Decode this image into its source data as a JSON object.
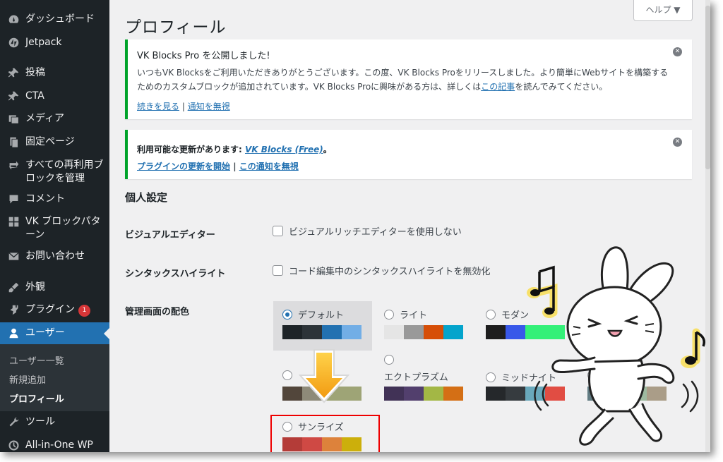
{
  "sidebar": {
    "items": [
      {
        "label": "ダッシュボード",
        "icon": "dashboard-icon"
      },
      {
        "label": "Jetpack",
        "icon": "jetpack-icon"
      },
      {
        "label": "投稿",
        "icon": "pin-icon"
      },
      {
        "label": "CTA",
        "icon": "pin-icon"
      },
      {
        "label": "メディア",
        "icon": "media-icon"
      },
      {
        "label": "固定ページ",
        "icon": "page-icon"
      },
      {
        "label": "すべての再利用ブロックを管理",
        "icon": "reusable-block-icon"
      },
      {
        "label": "コメント",
        "icon": "comment-icon"
      },
      {
        "label": "VK ブロックパターン",
        "icon": "grid-icon"
      },
      {
        "label": "お問い合わせ",
        "icon": "mail-icon"
      },
      {
        "label": "外観",
        "icon": "appearance-icon"
      },
      {
        "label": "プラグイン",
        "icon": "plugin-icon",
        "badge": "1"
      },
      {
        "label": "ユーザー",
        "icon": "user-icon"
      },
      {
        "label": "ツール",
        "icon": "tools-icon"
      },
      {
        "label": "All-in-One WP Migration",
        "icon": "migration-icon"
      }
    ],
    "submenu": [
      "ユーザー一覧",
      "新規追加",
      "プロフィール"
    ]
  },
  "page": {
    "title": "プロフィール",
    "help": "ヘルプ ▼"
  },
  "notice1": {
    "title": "VK Blocks Pro を公開しました!",
    "body_before": "いつもVK Blocksをご利用いただきありがとうございます。この度、VK Blocks Proをリリースしました。より簡単にWebサイトを構築するためのカスタムブロックが追加されています。VK Blocks Proに興味がある方は、詳しくは",
    "body_link": "この記事",
    "body_after": "を読んでみてください。",
    "link_more": "続きを見る",
    "separator": " | ",
    "link_dismiss": "通知を無視"
  },
  "notice2": {
    "title_before": "利用可能な更新があります: ",
    "title_link": "VK Blocks (Free)",
    "title_after": "。",
    "link_update": "プラグインの更新を開始",
    "separator": " | ",
    "link_dismiss": "この通知を無視"
  },
  "settings": {
    "section_title": "個人設定",
    "visual_editor_label": "ビジュアルエディター",
    "visual_editor_option": "ビジュアルリッチエディターを使用しない",
    "syntax_label": "シンタックスハイライト",
    "syntax_option": "コード編集中のシンタックスハイライトを無効化",
    "color_scheme_label": "管理画面の配色"
  },
  "color_schemes": [
    {
      "name": "デフォルト",
      "selected": true,
      "colors": [
        "#1d2327",
        "#2c3338",
        "#2271b1",
        "#72aee6"
      ]
    },
    {
      "name": "ライト",
      "selected": false,
      "colors": [
        "#e5e5e5",
        "#999999",
        "#d64e07",
        "#04a4cc"
      ]
    },
    {
      "name": "モダン",
      "selected": false,
      "colors": [
        "#1e1e1e",
        "#3858e9",
        "#33f078",
        "#33f078"
      ]
    },
    {
      "name": "",
      "selected": false,
      "colors": [
        "#52463b",
        "#8e8a79",
        "#9ea476",
        "#9ea476"
      ]
    },
    {
      "name": "エクトプラズム",
      "selected": false,
      "colors": [
        "#413256",
        "#523f6d",
        "#a3b745",
        "#d46f15"
      ]
    },
    {
      "name": "ミッドナイト",
      "selected": false,
      "colors": [
        "#25282b",
        "#363b3f",
        "#69a8bb",
        "#e14d43"
      ]
    },
    {
      "name": "",
      "selected": false,
      "colors": [
        "#627c83",
        "#738e96",
        "#9ebaa0",
        "#aa9d88"
      ]
    },
    {
      "name": "サンライズ",
      "selected": false,
      "colors": [
        "#b43c38",
        "#cf4944",
        "#dd823b",
        "#ccaf0b"
      ]
    }
  ]
}
